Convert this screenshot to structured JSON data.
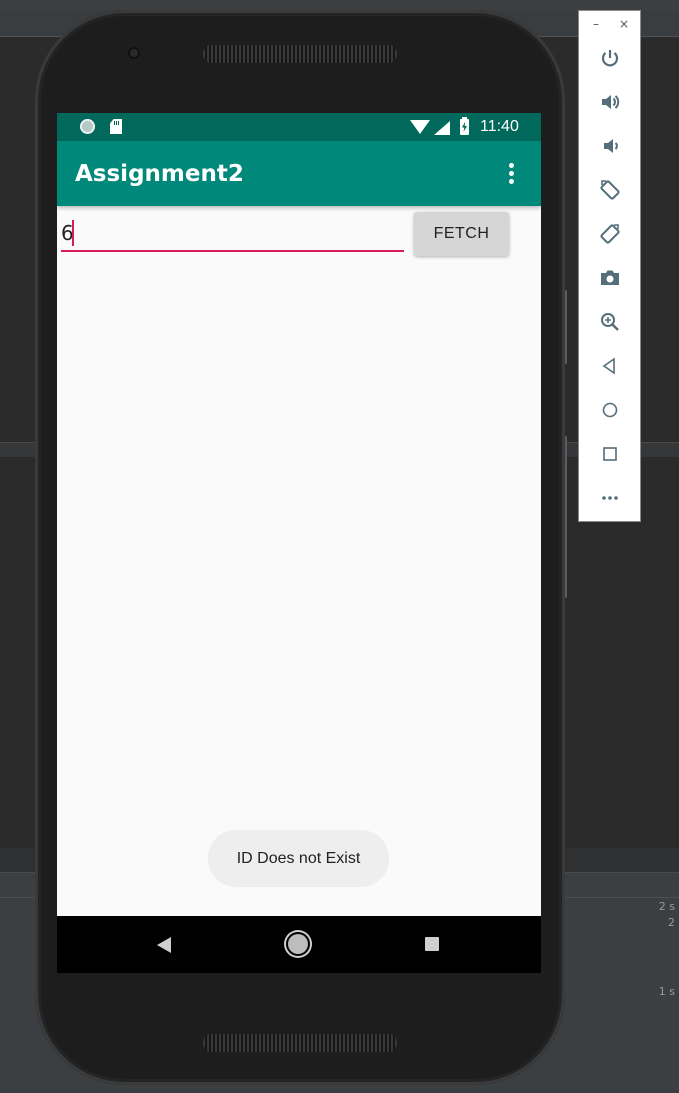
{
  "app": {
    "title": "Assignment2",
    "input_value": "6",
    "fetch_label": "FETCH",
    "toast_message": "ID Does not Exist"
  },
  "status_bar": {
    "time": "11:40"
  },
  "ide": {
    "right_labels": [
      "2 s",
      "2",
      "1 s"
    ]
  },
  "emulator_toolbar": {
    "minimize_label": "–",
    "close_label": "×",
    "items": [
      {
        "name": "power-icon"
      },
      {
        "name": "volume-up-icon"
      },
      {
        "name": "volume-down-icon"
      },
      {
        "name": "rotate-left-icon"
      },
      {
        "name": "rotate-right-icon"
      },
      {
        "name": "camera-icon"
      },
      {
        "name": "zoom-icon"
      },
      {
        "name": "back-icon"
      },
      {
        "name": "home-icon"
      },
      {
        "name": "overview-icon"
      },
      {
        "name": "more-icon"
      }
    ]
  },
  "colors": {
    "status_bar": "#00695c",
    "app_bar": "#00897b",
    "accent": "#d81b60",
    "toolbar_icon": "#546e7a"
  }
}
